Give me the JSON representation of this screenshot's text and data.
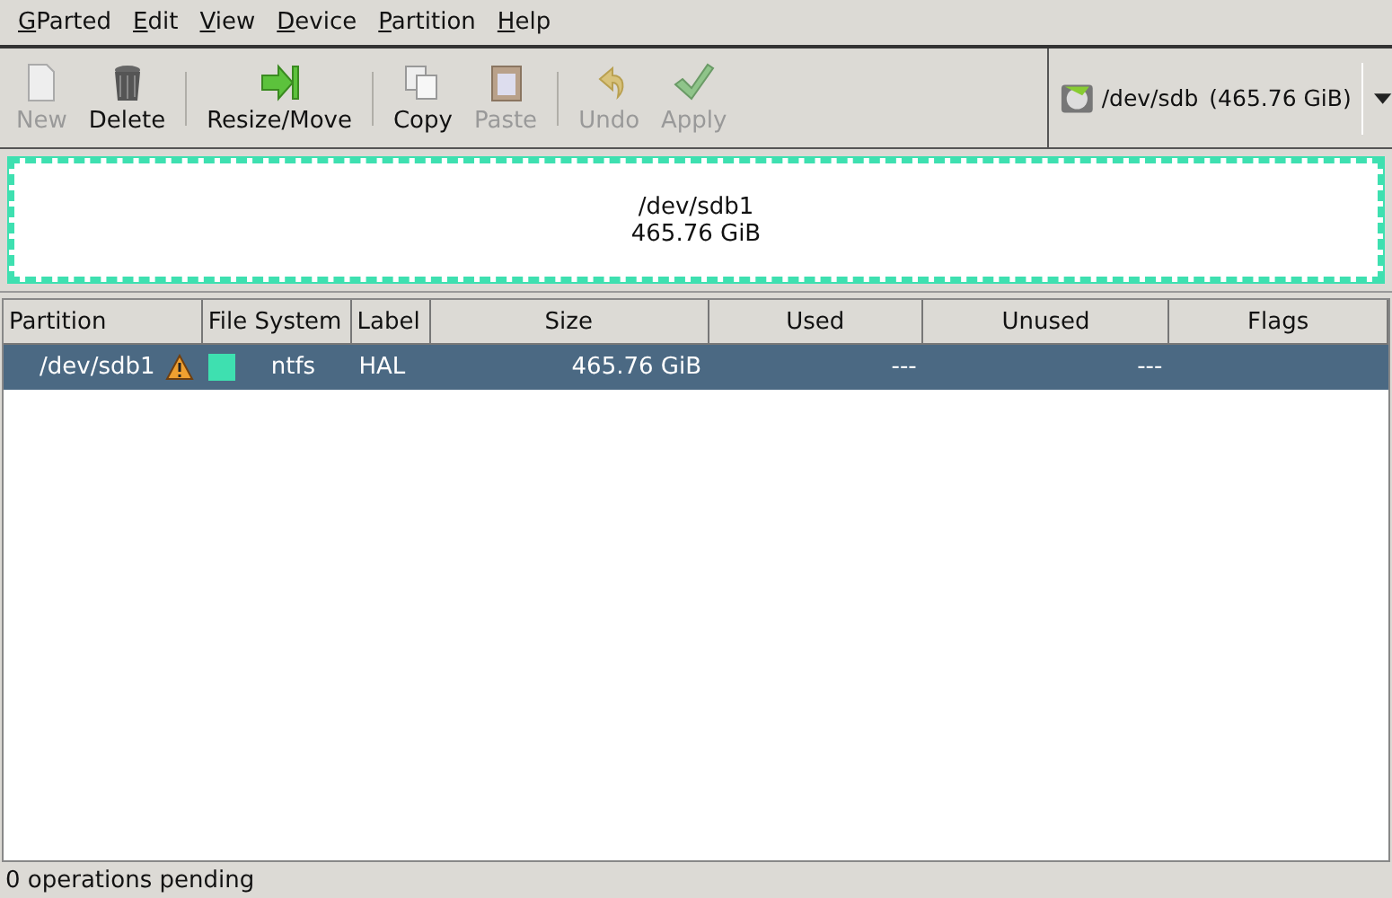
{
  "menu": [
    {
      "label": "GParted",
      "mnemonic": true
    },
    {
      "label": "Edit",
      "mnemonic": true
    },
    {
      "label": "View",
      "mnemonic": true
    },
    {
      "label": "Device",
      "mnemonic": true
    },
    {
      "label": "Partition",
      "mnemonic": true
    },
    {
      "label": "Help",
      "mnemonic": true
    }
  ],
  "toolbar": [
    {
      "label": "New",
      "kind": "new",
      "disabled": true
    },
    {
      "label": "Delete",
      "kind": "delete",
      "disabled": false
    },
    {
      "kind": "separator"
    },
    {
      "label": "Resize/Move",
      "kind": "resize",
      "disabled": false
    },
    {
      "kind": "separator"
    },
    {
      "label": "Copy",
      "kind": "copy",
      "disabled": false
    },
    {
      "label": "Paste",
      "kind": "paste",
      "disabled": true
    },
    {
      "kind": "separator"
    },
    {
      "label": "Undo",
      "kind": "undo",
      "disabled": true
    },
    {
      "label": "Apply",
      "kind": "apply",
      "disabled": true
    }
  ],
  "device": {
    "name": "/dev/sdb",
    "size": "(465.76 GiB)"
  },
  "partition_map": {
    "name": "/dev/sdb1",
    "size": "465.76 GiB",
    "color": "#3ee0b0"
  },
  "table": {
    "columns": [
      "Partition",
      "File System",
      "Label",
      "Size",
      "Used",
      "Unused",
      "Flags"
    ],
    "rows": [
      {
        "partition": "/dev/sdb1",
        "warning": true,
        "color": "#3ee0b0",
        "file_system": "ntfs",
        "label": "HAL",
        "size": "465.76 GiB",
        "used": "---",
        "unused": "---",
        "selected": true
      }
    ]
  },
  "status_bar": "0 operations pending"
}
